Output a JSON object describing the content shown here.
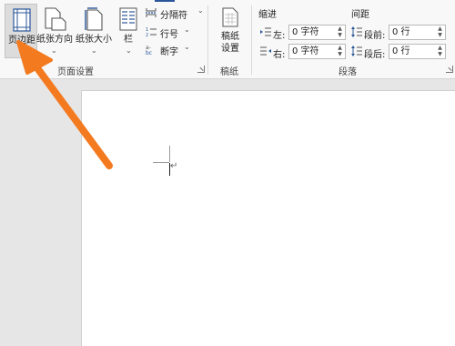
{
  "ribbon": {
    "margins_label": "页边距",
    "orientation_label": "纸张方向",
    "size_label": "纸张大小",
    "columns_label": "栏",
    "breaks_label": "分隔符",
    "line_numbers_label": "行号",
    "hyphenation_label": "断字",
    "page_setup_group": "页面设置",
    "manuscript_label_line1": "稿纸",
    "manuscript_label_line2": "设置",
    "manuscript_group": "稿纸",
    "indent_header": "缩进",
    "spacing_header": "间距",
    "indent_left_label": "左:",
    "indent_left_value": "0 字符",
    "indent_right_label": "右:",
    "indent_right_value": "0 字符",
    "spacing_before_label": "段前:",
    "spacing_before_value": "0 行",
    "spacing_after_label": "段后:",
    "spacing_after_value": "0 行",
    "paragraph_group": "段落"
  },
  "colors": {
    "accent": "#2b579a",
    "arrow": "#f47a20"
  }
}
